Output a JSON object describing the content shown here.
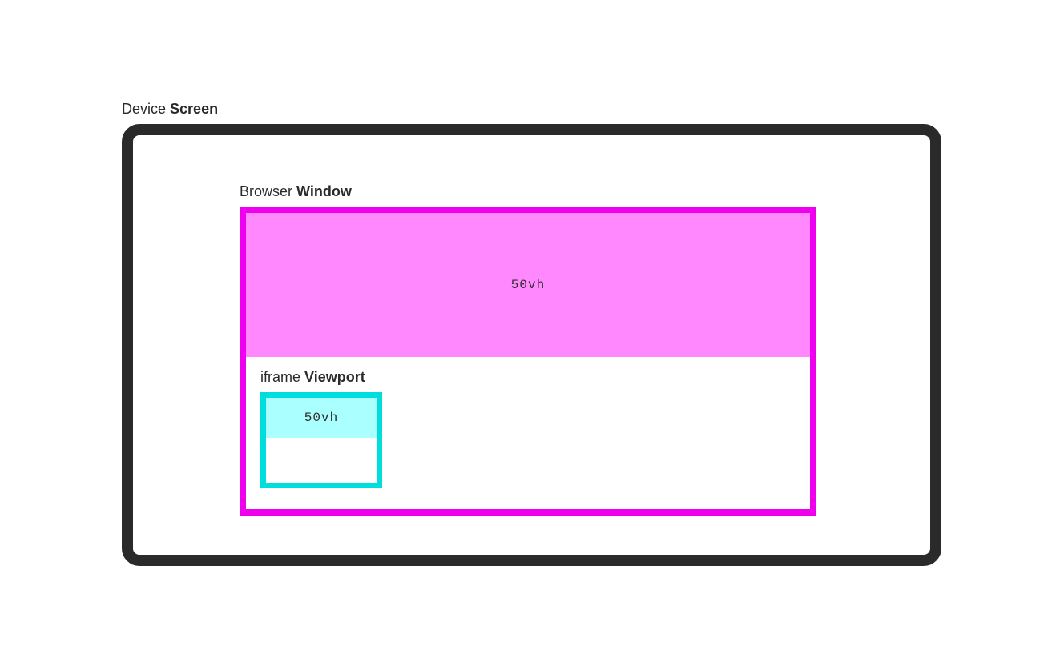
{
  "labels": {
    "screen_prefix": "Device ",
    "screen_bold": "Screen",
    "window_prefix": "Browser ",
    "window_bold": "Window",
    "iframe_prefix": "iframe ",
    "iframe_bold": "Viewport",
    "window_vh": "50vh",
    "iframe_vh": "50vh"
  },
  "colors": {
    "screen_border": "#2a2a2a",
    "window_border": "#ee00ee",
    "window_fill": "#ff88ff",
    "iframe_border": "#00dddd",
    "iframe_fill": "#aaffff"
  }
}
